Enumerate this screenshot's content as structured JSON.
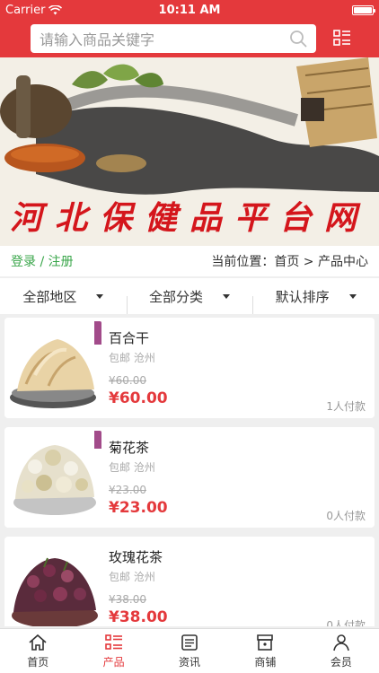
{
  "status_bar": {
    "carrier": "Carrier",
    "time": "10:11 AM"
  },
  "search": {
    "placeholder": "请输入商品关键字"
  },
  "banner": {
    "title": "河北保健品平台网"
  },
  "location_bar": {
    "login": "登录 / 注册",
    "location": "当前位置：首页 > 产品中心"
  },
  "filters": [
    {
      "label": "全部地区"
    },
    {
      "label": "全部分类"
    },
    {
      "label": "默认排序"
    }
  ],
  "products": [
    {
      "name": "百合干",
      "meta": "包邮 沧州",
      "old_price": "¥60.00",
      "price": "¥60.00",
      "sold": "1人付款"
    },
    {
      "name": "菊花茶",
      "meta": "包邮 沧州",
      "old_price": "¥23.00",
      "price": "¥23.00",
      "sold": "0人付款"
    },
    {
      "name": "玫瑰花茶",
      "meta": "包邮 沧州",
      "old_price": "¥38.00",
      "price": "¥38.00",
      "sold": "0人付款"
    }
  ],
  "tabs": [
    {
      "label": "首页",
      "icon": "home-icon",
      "active": false
    },
    {
      "label": "产品",
      "icon": "list-icon",
      "active": true
    },
    {
      "label": "资讯",
      "icon": "news-icon",
      "active": false
    },
    {
      "label": "商铺",
      "icon": "shop-icon",
      "active": false
    },
    {
      "label": "会员",
      "icon": "person-icon",
      "active": false
    }
  ],
  "colors": {
    "brand": "#e4393c",
    "login": "#39a64a"
  }
}
